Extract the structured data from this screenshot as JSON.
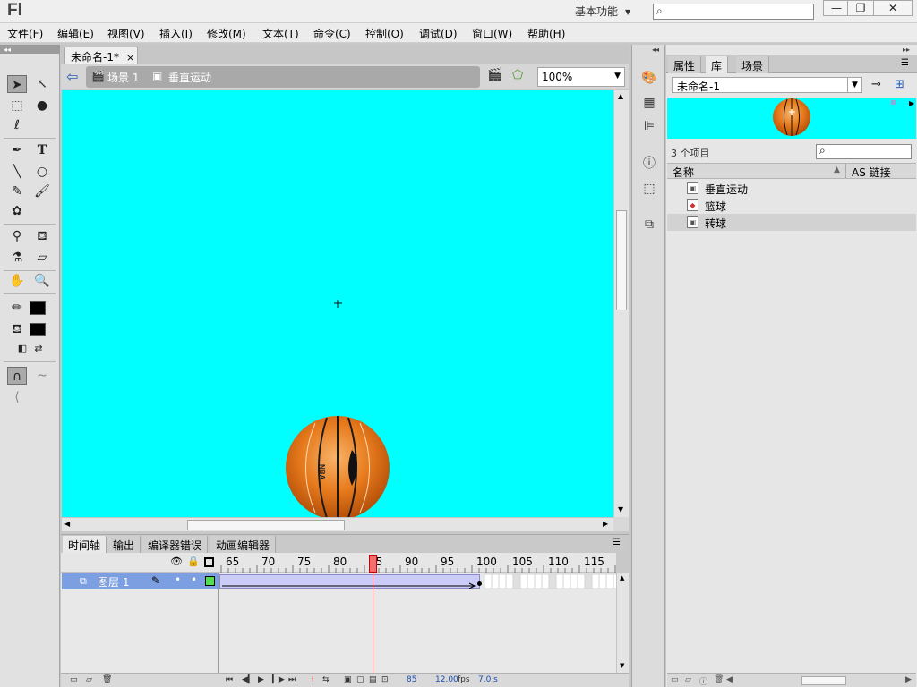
{
  "app": {
    "logo": "Fl"
  },
  "titlebar": {
    "workspace_label": "基本功能",
    "search_placeholder": "",
    "minimize": "—",
    "restore": "❐",
    "close": "✕"
  },
  "menu": {
    "items": [
      "文件(F)",
      "编辑(E)",
      "视图(V)",
      "插入(I)",
      "修改(M)",
      "文本(T)",
      "命令(C)",
      "控制(O)",
      "调试(D)",
      "窗口(W)",
      "帮助(H)"
    ]
  },
  "document": {
    "tab_title": "未命名-1*",
    "tab_close": "×",
    "breadcrumb": {
      "scene": "场景 1",
      "symbol": "垂直运动"
    },
    "zoom": "100%",
    "stage_color": "#00ffff",
    "ball_label": "NBA"
  },
  "timeline": {
    "tabs": [
      "时间轴",
      "输出",
      "编译器错误",
      "动画编辑器"
    ],
    "ruler_ticks": [
      "65",
      "70",
      "75",
      "80",
      "85",
      "90",
      "95",
      "100",
      "105",
      "110",
      "115"
    ],
    "layer_name": "图层 1",
    "current_frame": "85",
    "fps_value": "12.00",
    "fps_unit": "fps",
    "elapsed": "7.0 s"
  },
  "library": {
    "tabs": [
      "属性",
      "库",
      "场景"
    ],
    "document_select": "未命名-1",
    "item_count": "3 个项目",
    "col_name": "名称",
    "col_linkage": "AS 链接",
    "items": [
      {
        "name": "垂直运动"
      },
      {
        "name": "篮球"
      },
      {
        "name": "转球"
      }
    ]
  }
}
